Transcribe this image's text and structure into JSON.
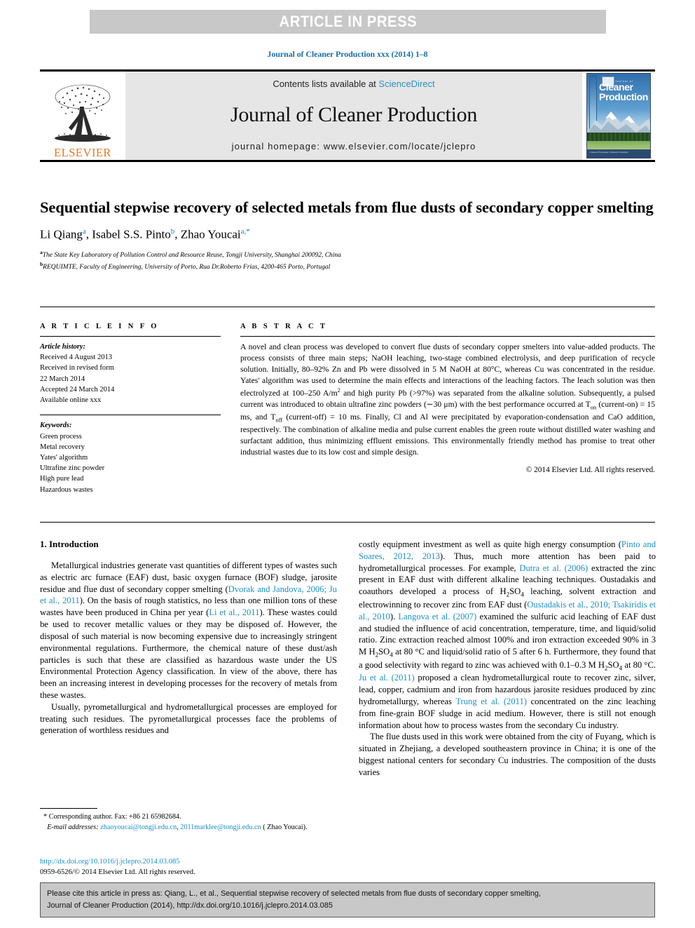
{
  "banner": {
    "text": "ARTICLE IN PRESS"
  },
  "running_head": {
    "text": "Journal of Cleaner Production xxx (2014) 1–8",
    "color": "#1a6fa8"
  },
  "masthead": {
    "publisher_logo_name": "elsevier-tree-logo",
    "publisher_name": "ELSEVIER",
    "publisher_color": "#e87722",
    "contents_prefix": "Contents lists available at",
    "contents_link": "ScienceDirect",
    "contents_link_color": "#2e8fc4",
    "journal_title": "Journal of Cleaner Production",
    "homepage": "journal homepage: www.elsevier.com/locate/jclepro",
    "cover": {
      "small_top": "Journal of",
      "title": "Cleaner Production",
      "footer_left": "▪ Cleaner Processes   ▪ Cleaner Production",
      "footer_right": "▪ Cleaner Products   ▪ Cleaner Consumption"
    }
  },
  "article": {
    "title": "Sequential stepwise recovery of selected metals from flue dusts of secondary copper smelting",
    "authors": [
      {
        "name": "Li Qiang",
        "marks": "a"
      },
      {
        "name": "Isabel S.S. Pinto",
        "marks": "b"
      },
      {
        "name": "Zhao Youcai",
        "marks": "a,*"
      }
    ],
    "affiliations": [
      {
        "mark": "a",
        "text": "The State Key Laboratory of Pollution Control and Resource Reuse, Tongji University, Shanghai 200092, China"
      },
      {
        "mark": "b",
        "text": "REQUIMTE, Faculty of Engineering, University of Porto, Rua Dr.Roberto Frias, 4200-465 Porto, Portugal"
      }
    ]
  },
  "info": {
    "heading": "A R T I C L E   I N F O",
    "history_label": "Article history:",
    "history": [
      "Received 4 August 2013",
      "Received in revised form",
      "22 March 2014",
      "Accepted 24 March 2014",
      "Available online xxx"
    ],
    "keywords_label": "Keywords:",
    "keywords": [
      "Green process",
      "Metal recovery",
      "Yates' algorithm",
      "Ultrafine zinc powder",
      "High pure lead",
      "Hazardous wastes"
    ]
  },
  "abstract": {
    "heading": "A B S T R A C T",
    "copyright": "© 2014 Elsevier Ltd. All rights reserved.",
    "paragraph_parts": {
      "p1": "A novel and clean process was developed to convert flue dusts of secondary copper smelters into value-added products. The process consists of three main steps; NaOH leaching, two-stage combined electrolysis, and deep purification of recycle solution. Initially, 80–92% Zn and Pb were dissolved in 5 M NaOH at 80°C, whereas Cu was concentrated in the residue. Yates' algorithm was used to determine the main effects and interactions of the leaching factors. The leach solution was then electrolyzed at 100–250 A/m",
      "sup1": "2",
      "p2": " and high purity Pb (>97%) was separated from the alkaline solution. Subsequently, a pulsed current was introduced to obtain ultrafine zinc powders (∼30 μm) with the best performance occurred at T",
      "sub1": "on",
      "p3": " (current-on) = 15 ms, and T",
      "sub2": "off",
      "p4": " (current-off) = 10 ms. Finally, Cl and Al were precipitated by evaporation-condensation and CaO addition, respectively. The combination of alkaline media and pulse current enables the green route without distilled water washing and surfactant addition, thus minimizing effluent emissions. This environmentally friendly method has promise to treat other industrial wastes due to its low cost and simple design."
    }
  },
  "body": {
    "section_heading": "1.  Introduction",
    "left": {
      "para1": {
        "a": "Metallurgical industries generate vast quantities of different types of wastes such as electric arc furnace (EAF) dust, basic oxygen furnace (BOF) sludge, jarosite residue and flue dust of secondary copper smelting (",
        "ref1": "Dvorak and Jandova, 2006; Ju et al., 2011",
        "b": "). On the basis of rough statistics, no less than one million tons of these wastes have been produced in China per year (",
        "ref2": "Li et al., 2011",
        "c": "). These wastes could be used to recover metallic values or they may be disposed of. However, the disposal of such material is now becoming expensive due to increasingly stringent environmental regulations. Furthermore, the chemical nature of these dust/ash particles is such that these are classified as hazardous waste under the US Environmental Protection Agency classification. In view of the above, there has been an increasing interest in developing processes for the recovery of metals from these wastes."
      },
      "para2": "Usually, pyrometallurgical and hydrometallurgical processes are employed for treating such residues. The pyrometallurgical processes face the problems of generation of worthless residues and"
    },
    "right": {
      "para1": {
        "a": "costly equipment investment as well as quite high energy consumption (",
        "ref1": "Pinto and Soares, 2012, 2013",
        "b": "). Thus, much more attention has been paid to hydrometallurgical processes. For example, ",
        "ref2": "Dutra et al. (2006)",
        "c": " extracted the zinc present in EAF dust with different alkaline leaching techniques. Oustadakis and coauthors developed a process of H",
        "sub1": "2",
        "c2": "SO",
        "sub2": "4",
        "c3": " leaching, solvent extraction and electrowinning to recover zinc from EAF dust (",
        "ref3": "Oustadakis et al., 2010; Tsakiridis et al., 2010",
        "d": "). ",
        "ref4": "Langova et al. (2007)",
        "e": " examined the sulfuric acid leaching of EAF dust and studied the influence of acid concentration, temperature, time, and liquid/solid ratio. Zinc extraction reached almost 100% and iron extraction exceeded 90% in 3 M H",
        "sub3": "2",
        "e2": "SO",
        "sub4": "4",
        "e3": " at 80 °C and liquid/solid ratio of 5 after 6 h. Furthermore, they found that a good selectivity with regard to zinc was achieved with 0.1–0.3 M H",
        "sub5": "2",
        "e4": "SO",
        "sub6": "4",
        "e5": " at 80 °C. ",
        "ref5": "Ju et al. (2011)",
        "f": " proposed a clean hydrometallurgical route to recover zinc, silver, lead, copper, cadmium and iron from hazardous jarosite residues produced by zinc hydrometallurgy, whereas ",
        "ref6": "Trung et al. (2011)",
        "g": " concentrated on the zinc leaching from fine-grain BOF sludge in acid medium. However, there is still not enough information about how to process wastes from the secondary Cu industry."
      },
      "para2": "The flue dusts used in this work were obtained from the city of Fuyang, which is situated in Zhejiang, a developed southeastern province in China; it is one of the biggest national centers for secondary Cu industries. The composition of the dusts varies"
    }
  },
  "footnote": {
    "star": "*",
    "corresponding": "Corresponding author. Fax: +86 21 65982684.",
    "email_label": "E-mail addresses:",
    "email1": "zhaoyoucai@tongji.edu.cn",
    "email_sep": ", ",
    "email2": "2011marklee@tongji.edu.cn",
    "email_suffix": " ( Zhao Youcai).",
    "doi_link": "http://dx.doi.org/10.1016/j.jclepro.2014.03.085",
    "issn_line": "0959-6526/© 2014 Elsevier Ltd. All rights reserved."
  },
  "cite_box": {
    "line1": "Please cite this article in press as: Qiang, L., et al., Sequential stepwise recovery of selected metals from flue dusts of secondary copper smelting,",
    "line2": "Journal of Cleaner Production (2014), http://dx.doi.org/10.1016/j.jclepro.2014.03.085"
  }
}
